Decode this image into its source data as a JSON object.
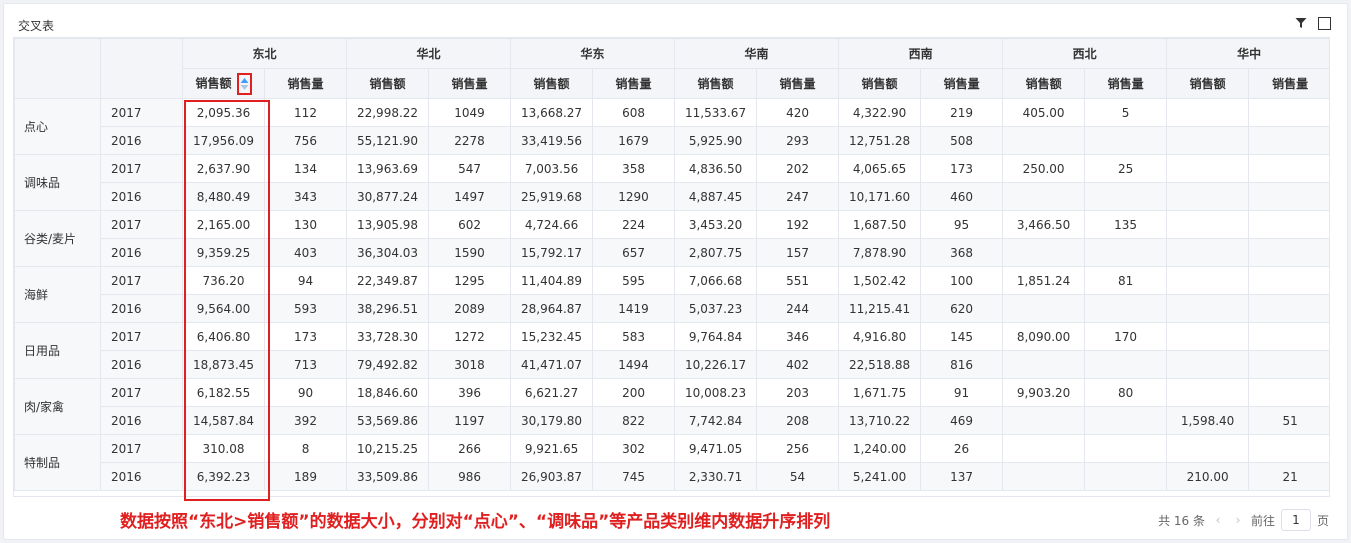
{
  "widget": {
    "title": "交叉表"
  },
  "table": {
    "regions": [
      "东北",
      "华北",
      "华东",
      "华南",
      "西南",
      "西北",
      "华中"
    ],
    "measures": [
      "销售额",
      "销售量"
    ],
    "rows": [
      {
        "category": "点心",
        "year": "2017",
        "cells": [
          "2,095.36",
          "112",
          "22,998.22",
          "1049",
          "13,668.27",
          "608",
          "11,533.67",
          "420",
          "4,322.90",
          "219",
          "405.00",
          "5",
          "",
          ""
        ]
      },
      {
        "category": "",
        "year": "2016",
        "cells": [
          "17,956.09",
          "756",
          "55,121.90",
          "2278",
          "33,419.56",
          "1679",
          "5,925.90",
          "293",
          "12,751.28",
          "508",
          "",
          "",
          "",
          ""
        ]
      },
      {
        "category": "调味品",
        "year": "2017",
        "cells": [
          "2,637.90",
          "134",
          "13,963.69",
          "547",
          "7,003.56",
          "358",
          "4,836.50",
          "202",
          "4,065.65",
          "173",
          "250.00",
          "25",
          "",
          ""
        ]
      },
      {
        "category": "",
        "year": "2016",
        "cells": [
          "8,480.49",
          "343",
          "30,877.24",
          "1497",
          "25,919.68",
          "1290",
          "4,887.45",
          "247",
          "10,171.60",
          "460",
          "",
          "",
          "",
          ""
        ]
      },
      {
        "category": "谷类/麦片",
        "year": "2017",
        "cells": [
          "2,165.00",
          "130",
          "13,905.98",
          "602",
          "4,724.66",
          "224",
          "3,453.20",
          "192",
          "1,687.50",
          "95",
          "3,466.50",
          "135",
          "",
          ""
        ]
      },
      {
        "category": "",
        "year": "2016",
        "cells": [
          "9,359.25",
          "403",
          "36,304.03",
          "1590",
          "15,792.17",
          "657",
          "2,807.75",
          "157",
          "7,878.90",
          "368",
          "",
          "",
          "",
          ""
        ]
      },
      {
        "category": "海鲜",
        "year": "2017",
        "cells": [
          "736.20",
          "94",
          "22,349.87",
          "1295",
          "11,404.89",
          "595",
          "7,066.68",
          "551",
          "1,502.42",
          "100",
          "1,851.24",
          "81",
          "",
          ""
        ]
      },
      {
        "category": "",
        "year": "2016",
        "cells": [
          "9,564.00",
          "593",
          "38,296.51",
          "2089",
          "28,964.87",
          "1419",
          "5,037.23",
          "244",
          "11,215.41",
          "620",
          "",
          "",
          "",
          ""
        ]
      },
      {
        "category": "日用品",
        "year": "2017",
        "cells": [
          "6,406.80",
          "173",
          "33,728.30",
          "1272",
          "15,232.45",
          "583",
          "9,764.84",
          "346",
          "4,916.80",
          "145",
          "8,090.00",
          "170",
          "",
          ""
        ]
      },
      {
        "category": "",
        "year": "2016",
        "cells": [
          "18,873.45",
          "713",
          "79,492.82",
          "3018",
          "41,471.07",
          "1494",
          "10,226.17",
          "402",
          "22,518.88",
          "816",
          "",
          "",
          "",
          ""
        ]
      },
      {
        "category": "肉/家禽",
        "year": "2017",
        "cells": [
          "6,182.55",
          "90",
          "18,846.60",
          "396",
          "6,621.27",
          "200",
          "10,008.23",
          "203",
          "1,671.75",
          "91",
          "9,903.20",
          "80",
          "",
          ""
        ]
      },
      {
        "category": "",
        "year": "2016",
        "cells": [
          "14,587.84",
          "392",
          "53,569.86",
          "1197",
          "30,179.80",
          "822",
          "7,742.84",
          "208",
          "13,710.22",
          "469",
          "",
          "",
          "1,598.40",
          "51"
        ]
      },
      {
        "category": "特制品",
        "year": "2017",
        "cells": [
          "310.08",
          "8",
          "10,215.25",
          "266",
          "9,921.65",
          "302",
          "9,471.05",
          "256",
          "1,240.00",
          "26",
          "",
          "",
          "",
          ""
        ]
      },
      {
        "category": "",
        "year": "2016",
        "cells": [
          "6,392.23",
          "189",
          "33,509.86",
          "986",
          "26,903.87",
          "745",
          "2,330.71",
          "54",
          "5,241.00",
          "137",
          "",
          "",
          "210.00",
          "21"
        ]
      }
    ]
  },
  "annotation": "数据按照“东北>销售额”的数据大小，分别对“点心”、“调味品”等产品类别维内数据升序排列",
  "pager": {
    "total": "共 16 条",
    "goto": "前往",
    "page": "1",
    "unit": "页"
  },
  "colors": {
    "accent": "#e02020",
    "sort_icon": "#409eff"
  }
}
